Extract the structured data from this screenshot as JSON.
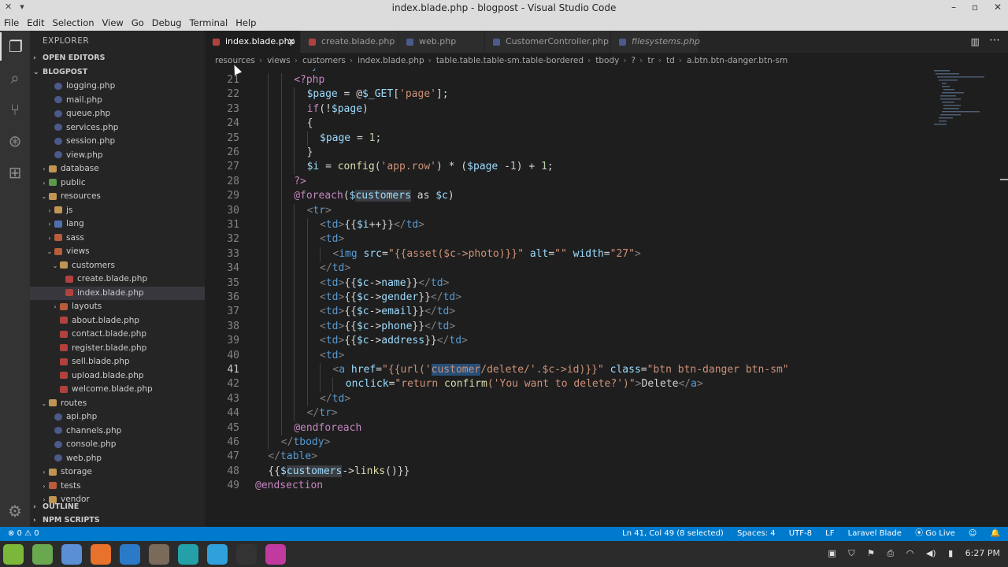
{
  "window": {
    "title": "index.blade.php - blogpost - Visual Studio Code"
  },
  "menu": [
    "File",
    "Edit",
    "Selection",
    "View",
    "Go",
    "Debug",
    "Terminal",
    "Help"
  ],
  "sidebar": {
    "header": "EXPLORER",
    "open_editors": "OPEN EDITORS",
    "project": "BLOGPOST",
    "tree": [
      {
        "label": "logging.php",
        "type": "php",
        "depth": 3
      },
      {
        "label": "mail.php",
        "type": "php",
        "depth": 3
      },
      {
        "label": "queue.php",
        "type": "php",
        "depth": 3
      },
      {
        "label": "services.php",
        "type": "php",
        "depth": 3
      },
      {
        "label": "session.php",
        "type": "php",
        "depth": 3
      },
      {
        "label": "view.php",
        "type": "php",
        "depth": 3
      },
      {
        "label": "database",
        "type": "folder",
        "depth": 2,
        "arrow": ">"
      },
      {
        "label": "public",
        "type": "folder-green",
        "depth": 2,
        "arrow": ">"
      },
      {
        "label": "resources",
        "type": "folder",
        "depth": 2,
        "arrow": "v"
      },
      {
        "label": "js",
        "type": "folder",
        "depth": 3,
        "arrow": ">"
      },
      {
        "label": "lang",
        "type": "folder-blue",
        "depth": 3,
        "arrow": ">"
      },
      {
        "label": "sass",
        "type": "folder-red",
        "depth": 3,
        "arrow": ">"
      },
      {
        "label": "views",
        "type": "folder-red",
        "depth": 3,
        "arrow": "v"
      },
      {
        "label": "customers",
        "type": "folder",
        "depth": 4,
        "arrow": "v"
      },
      {
        "label": "create.blade.php",
        "type": "blade",
        "depth": 5
      },
      {
        "label": "index.blade.php",
        "type": "blade",
        "depth": 5,
        "selected": true
      },
      {
        "label": "layouts",
        "type": "folder-red",
        "depth": 4,
        "arrow": ">"
      },
      {
        "label": "about.blade.php",
        "type": "blade",
        "depth": 4
      },
      {
        "label": "contact.blade.php",
        "type": "blade",
        "depth": 4
      },
      {
        "label": "register.blade.php",
        "type": "blade",
        "depth": 4
      },
      {
        "label": "sell.blade.php",
        "type": "blade",
        "depth": 4
      },
      {
        "label": "upload.blade.php",
        "type": "blade",
        "depth": 4
      },
      {
        "label": "welcome.blade.php",
        "type": "blade",
        "depth": 4
      },
      {
        "label": "routes",
        "type": "folder",
        "depth": 2,
        "arrow": "v"
      },
      {
        "label": "api.php",
        "type": "php",
        "depth": 3
      },
      {
        "label": "channels.php",
        "type": "php",
        "depth": 3
      },
      {
        "label": "console.php",
        "type": "php",
        "depth": 3
      },
      {
        "label": "web.php",
        "type": "php",
        "depth": 3
      },
      {
        "label": "storage",
        "type": "folder",
        "depth": 2,
        "arrow": ">"
      },
      {
        "label": "tests",
        "type": "folder-red",
        "depth": 2,
        "arrow": ">"
      },
      {
        "label": "vendor",
        "type": "folder",
        "depth": 2,
        "arrow": ">"
      }
    ],
    "outline": "OUTLINE",
    "npm_scripts": "NPM SCRIPTS"
  },
  "tabs": [
    {
      "label": "index.blade.php",
      "active": true,
      "icon": "blade"
    },
    {
      "label": "create.blade.php",
      "active": false,
      "icon": "blade"
    },
    {
      "label": "web.php",
      "active": false,
      "icon": "php"
    },
    {
      "label": "CustomerController.php",
      "active": false,
      "icon": "php"
    },
    {
      "label": "filesystems.php",
      "active": false,
      "icon": "php",
      "italic": true
    }
  ],
  "breadcrumb": [
    "resources",
    "views",
    "customers",
    "index.blade.php",
    "table.table.table-sm.table-bordered",
    "tbody",
    "?",
    "tr",
    "td",
    "a.btn.btn-danger.btn-sm"
  ],
  "editor": {
    "current_line": 41,
    "top_partial": "<tbody>",
    "lines": [
      {
        "n": 21,
        "indent": 6,
        "tokens": [
          [
            "kw",
            "<?php"
          ]
        ]
      },
      {
        "n": 22,
        "indent": 8,
        "tokens": [
          [
            "var",
            "$page"
          ],
          [
            "txt",
            " = @"
          ],
          [
            "var",
            "$_GET"
          ],
          [
            "txt",
            "["
          ],
          [
            "str",
            "'page'"
          ],
          [
            "txt",
            "];"
          ]
        ]
      },
      {
        "n": 23,
        "indent": 8,
        "tokens": [
          [
            "kw",
            "if"
          ],
          [
            "txt",
            "(!"
          ],
          [
            "var",
            "$page"
          ],
          [
            "txt",
            ")"
          ]
        ]
      },
      {
        "n": 24,
        "indent": 8,
        "tokens": [
          [
            "txt",
            "{"
          ]
        ]
      },
      {
        "n": 25,
        "indent": 10,
        "tokens": [
          [
            "var",
            "$page"
          ],
          [
            "txt",
            " = "
          ],
          [
            "num",
            "1"
          ],
          [
            "txt",
            ";"
          ]
        ]
      },
      {
        "n": 26,
        "indent": 8,
        "tokens": [
          [
            "txt",
            "}"
          ]
        ]
      },
      {
        "n": 27,
        "indent": 8,
        "tokens": [
          [
            "var",
            "$i"
          ],
          [
            "txt",
            " = "
          ],
          [
            "fn",
            "config"
          ],
          [
            "txt",
            "("
          ],
          [
            "str",
            "'app.row'"
          ],
          [
            "txt",
            ") * ("
          ],
          [
            "var",
            "$page"
          ],
          [
            "txt",
            " -"
          ],
          [
            "num",
            "1"
          ],
          [
            "txt",
            ") + "
          ],
          [
            "num",
            "1"
          ],
          [
            "txt",
            ";"
          ]
        ]
      },
      {
        "n": 28,
        "indent": 6,
        "tokens": [
          [
            "kw",
            "?>"
          ]
        ]
      },
      {
        "n": 29,
        "indent": 6,
        "tokens": [
          [
            "kw",
            "@foreach"
          ],
          [
            "txt",
            "("
          ],
          [
            "var",
            "$"
          ],
          [
            "hl2",
            "customers"
          ],
          [
            "txt",
            " as "
          ],
          [
            "var",
            "$c"
          ],
          [
            "txt",
            ")"
          ]
        ]
      },
      {
        "n": 30,
        "indent": 8,
        "tokens": [
          [
            "br",
            "<"
          ],
          [
            "tag",
            "tr"
          ],
          [
            "br",
            ">"
          ]
        ]
      },
      {
        "n": 31,
        "indent": 10,
        "tokens": [
          [
            "br",
            "<"
          ],
          [
            "tag",
            "td"
          ],
          [
            "br",
            ">"
          ],
          [
            "txt",
            "{{"
          ],
          [
            "var",
            "$i"
          ],
          [
            "txt",
            "++}}"
          ],
          [
            "br",
            "</"
          ],
          [
            "tag",
            "td"
          ],
          [
            "br",
            ">"
          ]
        ]
      },
      {
        "n": 32,
        "indent": 10,
        "tokens": [
          [
            "br",
            "<"
          ],
          [
            "tag",
            "td"
          ],
          [
            "br",
            ">"
          ]
        ]
      },
      {
        "n": 33,
        "indent": 12,
        "tokens": [
          [
            "br",
            "<"
          ],
          [
            "tag",
            "img"
          ],
          [
            "txt",
            " "
          ],
          [
            "attr",
            "src"
          ],
          [
            "txt",
            "="
          ],
          [
            "str",
            "\"{{asset($c->photo)}}\""
          ],
          [
            "txt",
            " "
          ],
          [
            "attr",
            "alt"
          ],
          [
            "txt",
            "="
          ],
          [
            "str",
            "\"\""
          ],
          [
            "txt",
            " "
          ],
          [
            "attr",
            "width"
          ],
          [
            "txt",
            "="
          ],
          [
            "str",
            "\"27\""
          ],
          [
            "br",
            ">"
          ]
        ]
      },
      {
        "n": 34,
        "indent": 10,
        "tokens": [
          [
            "br",
            "</"
          ],
          [
            "tag",
            "td"
          ],
          [
            "br",
            ">"
          ]
        ]
      },
      {
        "n": 35,
        "indent": 10,
        "tokens": [
          [
            "br",
            "<"
          ],
          [
            "tag",
            "td"
          ],
          [
            "br",
            ">"
          ],
          [
            "txt",
            "{{"
          ],
          [
            "var",
            "$c"
          ],
          [
            "txt",
            "->"
          ],
          [
            "var",
            "name"
          ],
          [
            "txt",
            "}}"
          ],
          [
            "br",
            "</"
          ],
          [
            "tag",
            "td"
          ],
          [
            "br",
            ">"
          ]
        ]
      },
      {
        "n": 36,
        "indent": 10,
        "tokens": [
          [
            "br",
            "<"
          ],
          [
            "tag",
            "td"
          ],
          [
            "br",
            ">"
          ],
          [
            "txt",
            "{{"
          ],
          [
            "var",
            "$c"
          ],
          [
            "txt",
            "->"
          ],
          [
            "var",
            "gender"
          ],
          [
            "txt",
            "}}"
          ],
          [
            "br",
            "</"
          ],
          [
            "tag",
            "td"
          ],
          [
            "br",
            ">"
          ]
        ]
      },
      {
        "n": 37,
        "indent": 10,
        "tokens": [
          [
            "br",
            "<"
          ],
          [
            "tag",
            "td"
          ],
          [
            "br",
            ">"
          ],
          [
            "txt",
            "{{"
          ],
          [
            "var",
            "$c"
          ],
          [
            "txt",
            "->"
          ],
          [
            "var",
            "email"
          ],
          [
            "txt",
            "}}"
          ],
          [
            "br",
            "</"
          ],
          [
            "tag",
            "td"
          ],
          [
            "br",
            ">"
          ]
        ]
      },
      {
        "n": 38,
        "indent": 10,
        "tokens": [
          [
            "br",
            "<"
          ],
          [
            "tag",
            "td"
          ],
          [
            "br",
            ">"
          ],
          [
            "txt",
            "{{"
          ],
          [
            "var",
            "$c"
          ],
          [
            "txt",
            "->"
          ],
          [
            "var",
            "phone"
          ],
          [
            "txt",
            "}}"
          ],
          [
            "br",
            "</"
          ],
          [
            "tag",
            "td"
          ],
          [
            "br",
            ">"
          ]
        ]
      },
      {
        "n": 39,
        "indent": 10,
        "tokens": [
          [
            "br",
            "<"
          ],
          [
            "tag",
            "td"
          ],
          [
            "br",
            ">"
          ],
          [
            "txt",
            "{{"
          ],
          [
            "var",
            "$c"
          ],
          [
            "txt",
            "->"
          ],
          [
            "var",
            "address"
          ],
          [
            "txt",
            "}}"
          ],
          [
            "br",
            "</"
          ],
          [
            "tag",
            "td"
          ],
          [
            "br",
            ">"
          ]
        ]
      },
      {
        "n": 40,
        "indent": 10,
        "tokens": [
          [
            "br",
            "<"
          ],
          [
            "tag",
            "td"
          ],
          [
            "br",
            ">"
          ]
        ]
      },
      {
        "n": 41,
        "indent": 12,
        "tokens": [
          [
            "br",
            "<"
          ],
          [
            "tag",
            "a"
          ],
          [
            "txt",
            " "
          ],
          [
            "attr",
            "href"
          ],
          [
            "txt",
            "="
          ],
          [
            "str",
            "\"{{url('"
          ],
          [
            "hl",
            "customer"
          ],
          [
            "str",
            "/delete/'.$c->id)}}\""
          ],
          [
            "txt",
            " "
          ],
          [
            "attr",
            "class"
          ],
          [
            "txt",
            "="
          ],
          [
            "str",
            "\"btn btn-danger btn-sm\""
          ]
        ]
      },
      {
        "n": 42,
        "indent": 14,
        "tokens": [
          [
            "attr",
            "onclick"
          ],
          [
            "txt",
            "="
          ],
          [
            "str",
            "\"return "
          ],
          [
            "fn",
            "confirm"
          ],
          [
            "str",
            "('You want to delete?')\""
          ],
          [
            "br",
            ">"
          ],
          [
            "txt",
            "Delete"
          ],
          [
            "br",
            "</"
          ],
          [
            "tag",
            "a"
          ],
          [
            "br",
            ">"
          ]
        ]
      },
      {
        "n": 43,
        "indent": 10,
        "tokens": [
          [
            "br",
            "</"
          ],
          [
            "tag",
            "td"
          ],
          [
            "br",
            ">"
          ]
        ]
      },
      {
        "n": 44,
        "indent": 8,
        "tokens": [
          [
            "br",
            "</"
          ],
          [
            "tag",
            "tr"
          ],
          [
            "br",
            ">"
          ]
        ]
      },
      {
        "n": 45,
        "indent": 6,
        "tokens": [
          [
            "kw",
            "@endforeach"
          ]
        ]
      },
      {
        "n": 46,
        "indent": 4,
        "tokens": [
          [
            "br",
            "</"
          ],
          [
            "tag",
            "tbody"
          ],
          [
            "br",
            ">"
          ]
        ]
      },
      {
        "n": 47,
        "indent": 2,
        "tokens": [
          [
            "br",
            "</"
          ],
          [
            "tag",
            "table"
          ],
          [
            "br",
            ">"
          ]
        ]
      },
      {
        "n": 48,
        "indent": 2,
        "tokens": [
          [
            "txt",
            "{{"
          ],
          [
            "var",
            "$"
          ],
          [
            "hl2",
            "customers"
          ],
          [
            "txt",
            "->"
          ],
          [
            "fn",
            "links"
          ],
          [
            "txt",
            "()}}"
          ]
        ]
      },
      {
        "n": 49,
        "indent": 0,
        "tokens": [
          [
            "kw",
            "@endsection"
          ]
        ]
      }
    ]
  },
  "statusbar": {
    "problems": "⊗ 0  ⚠ 0",
    "position": "Ln 41, Col 49 (8 selected)",
    "spaces": "Spaces: 4",
    "encoding": "UTF-8",
    "eol": "LF",
    "language": "Laravel Blade",
    "golive": "⦿ Go Live",
    "feedback": "☺",
    "bell": "🔔"
  },
  "taskbar": {
    "clock": "6:27 PM",
    "apps": [
      {
        "name": "mint-menu",
        "color": "#7bb83a"
      },
      {
        "name": "files",
        "color": "#6aa84f"
      },
      {
        "name": "chromium",
        "color": "#5a8fd6"
      },
      {
        "name": "firefox",
        "color": "#e8722c"
      },
      {
        "name": "vscode",
        "color": "#2a7ac7"
      },
      {
        "name": "gimp",
        "color": "#7a6a5a"
      },
      {
        "name": "pycharm",
        "color": "#24a0a8"
      },
      {
        "name": "telegram",
        "color": "#2fa0db"
      },
      {
        "name": "terminal",
        "color": "#333333"
      },
      {
        "name": "recorder",
        "color": "#c03aa0"
      }
    ]
  },
  "colors": {
    "accent": "#007acc",
    "editor_bg": "#1e1e1e",
    "sidebar_bg": "#252526"
  }
}
